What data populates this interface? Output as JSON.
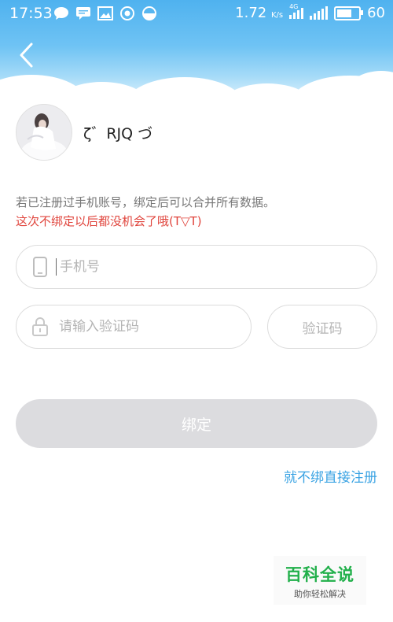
{
  "status_bar": {
    "time": "17:53",
    "network_speed": "1.72",
    "speed_unit": "K/s",
    "network_type": "4G",
    "battery": "60",
    "icons": [
      "chat-bubble-icon",
      "message-icon",
      "image-icon",
      "app-icon",
      "toggle-icon"
    ]
  },
  "header": {
    "back_icon": "chevron-left-icon"
  },
  "profile": {
    "username": "ζ゛RJQ づ"
  },
  "notice": {
    "info": "若已注册过手机账号，绑定后可以合并所有数据。",
    "warning": "这次不绑定以后都没机会了哦(T▽T)"
  },
  "form": {
    "phone_placeholder": "手机号",
    "code_placeholder": "请输入验证码",
    "get_code_label": "验证码",
    "bind_label": "绑定",
    "skip_label": "就不绑直接注册"
  },
  "watermark": {
    "title": "百科全说",
    "subtitle": "助你轻松解决"
  },
  "colors": {
    "header_blue": "#4fb2ef",
    "warning_red": "#e0443c",
    "link_blue": "#3aa3e3",
    "disabled_button": "#dcdcdf",
    "watermark_green": "#22b04b"
  }
}
